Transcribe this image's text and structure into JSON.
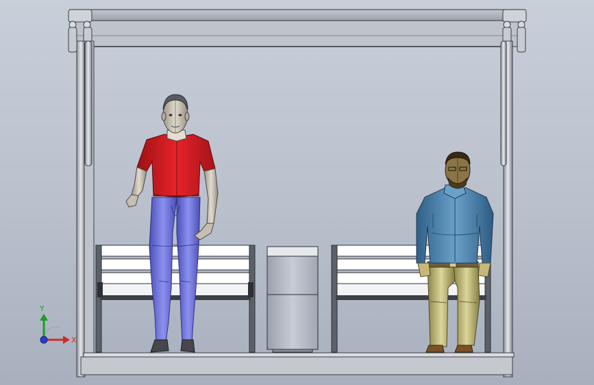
{
  "viewport": {
    "background_top": "#c9cfd9",
    "background_bottom": "#a8b0be"
  },
  "triad": {
    "y_label": "Y",
    "x_label": "X",
    "y_color": "#1f9a2a",
    "x_color": "#d22a2a",
    "z_color": "#2440d0"
  },
  "colors": {
    "frame_gray": "#b7bbc4",
    "bench_white": "#ffffff",
    "bench_dark": "#3c3f46",
    "bin_body": "#b8bdc8",
    "shirt_red": "#d81e24",
    "pants_purple": "#6a6fe0",
    "denim_shirt": "#4f86b0",
    "khaki_pants": "#bcb46e",
    "skin": "#c9c0b0",
    "dark_skin": "#6b5a3a"
  },
  "icons": {
    "triad": "coordinate-triad-icon"
  }
}
